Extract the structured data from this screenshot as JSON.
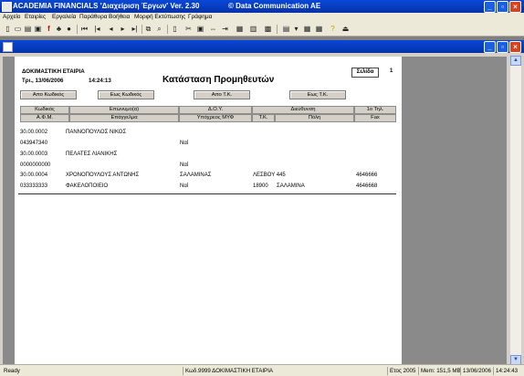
{
  "app": {
    "title": "ACADEMIA FINANCIALS 'Διαχείριση Έργων' Ver. 2.30",
    "copyright": "© Data Communication AE"
  },
  "menu": [
    "Αρχείο",
    "Εταιρίες",
    "Εργαλεία",
    "Παράθυρα",
    "Βοήθεια",
    "Μορφή Εκτύπωσης",
    "Γράφημα"
  ],
  "report": {
    "company": "ΔΟΚΙΜΑΣΤΙΚΗ ΕΤΑΙΡΙΑ",
    "date": "Τρι., 13/06/2006",
    "time": "14:24:13",
    "title": "Κατάσταση Προμηθευτών",
    "page_label": "Σελίδα",
    "page_number": "1",
    "filters": [
      "Απο Κωδικός",
      "Εως Κωδικός",
      "Απο Τ.Κ.",
      "Εως Τ.Κ."
    ],
    "headers_row1": [
      "Κωδικός",
      "Επώνυμο(α)",
      "Δ.Ο.Υ.",
      "Διεύθυνση",
      "1ο Τηλ."
    ],
    "headers_row2": [
      "Α.Φ.Μ.",
      "Επάγγελμα",
      "Υπόχρεος ΜΥΦ",
      "Τ.Κ.",
      "Πόλη",
      "Fax"
    ],
    "records": [
      {
        "code": "30.00.0002",
        "name": "ΠΑΝΝΟΠΟΥΛΟΣ ΝΙΚΟΣ",
        "doy": "",
        "address": "",
        "phone": "",
        "afm": "043947340",
        "profession": "",
        "myf": "Ναί",
        "tk": "",
        "city": "",
        "fax": ""
      },
      {
        "code": "30.00.0003",
        "name": "ΠΕΛΑΤΕΣ ΛΙΑΝΙΚΗΣ",
        "doy": "",
        "address": "",
        "phone": "",
        "afm": "0000000000",
        "profession": "",
        "myf": "Ναί",
        "tk": "",
        "city": "",
        "fax": ""
      },
      {
        "code": "30.00.0004",
        "name": "ΧΡΟΝΟΠΟΥΛΟΥΣ ΑΝΤΩΝΗΣ",
        "doy": "ΣΑΛΑΜΙΝΑΣ",
        "address": "ΛΕΣΒΟΥ 445",
        "phone": "4646666",
        "afm": "033333333",
        "profession": "ΦΑΚΕΛΟΠΟΙΕΙΟ",
        "myf": "Ναί",
        "tk": "18900",
        "city": "ΣΑΛΑΜΙΝΑ",
        "fax": "4646668"
      }
    ]
  },
  "status": {
    "ready": "Ready",
    "company": "Κωδ.9999 ΔΟΚΙΜΑΣΤΙΚΗ ΕΤΑΙΡΙΑ",
    "year": "Ετος 2005",
    "memory": "Mem: 151,5 MB",
    "date": "13/06/2006",
    "time": "14:24:43"
  }
}
